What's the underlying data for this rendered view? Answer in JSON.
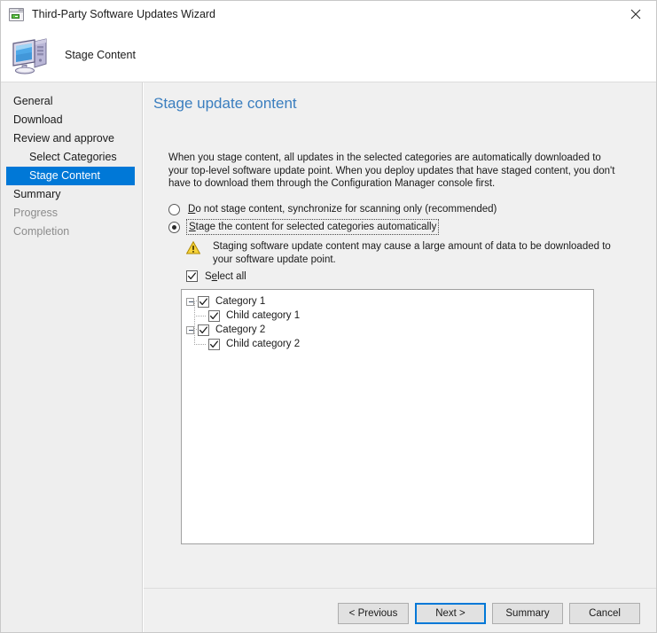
{
  "window": {
    "title": "Third-Party Software Updates Wizard",
    "title_icon": "wizard-window-icon",
    "close_icon": "close-icon"
  },
  "header": {
    "icon": "computer-icon",
    "title": "Stage Content"
  },
  "sidebar": {
    "items": [
      {
        "label": "General",
        "state": "normal",
        "indent": 0
      },
      {
        "label": "Download",
        "state": "normal",
        "indent": 0
      },
      {
        "label": "Review and approve",
        "state": "normal",
        "indent": 0
      },
      {
        "label": "Select Categories",
        "state": "normal",
        "indent": 1
      },
      {
        "label": "Stage Content",
        "state": "active",
        "indent": 1
      },
      {
        "label": "Summary",
        "state": "normal",
        "indent": 0
      },
      {
        "label": "Progress",
        "state": "disabled",
        "indent": 0
      },
      {
        "label": "Completion",
        "state": "disabled",
        "indent": 0
      }
    ]
  },
  "main": {
    "heading": "Stage update content",
    "intro": "When you stage content, all updates in the selected categories are automatically downloaded to your top-level software update point. When you deploy updates that have staged content, you don't have to download them through the Configuration Manager console first.",
    "options": [
      {
        "id": "do-not-stage",
        "label_prefix": "D",
        "label_rest": "o not stage content, synchronize for scanning only (recommended)",
        "checked": false,
        "focused": false
      },
      {
        "id": "stage-automatically",
        "label_prefix": "S",
        "label_rest": "tage the content for selected categories automatically",
        "checked": true,
        "focused": true
      }
    ],
    "warning": {
      "icon": "warning-triangle-icon",
      "text": "Staging software update content may cause a large amount of data to be downloaded to your software update point."
    },
    "select_all": {
      "label_prefix": "S",
      "label_mid": "e",
      "label_rest": "lect all",
      "checked": true
    },
    "tree": {
      "nodes": [
        {
          "label": "Category 1",
          "checked": true,
          "expanded": true,
          "children": [
            {
              "label": "Child category 1",
              "checked": true
            }
          ]
        },
        {
          "label": "Category 2",
          "checked": true,
          "expanded": true,
          "children": [
            {
              "label": "Child category 2",
              "checked": true
            }
          ]
        }
      ]
    }
  },
  "footer": {
    "previous": {
      "label": "< Previous",
      "accel": "P",
      "default": false
    },
    "next": {
      "label": "Next >",
      "accel": "N",
      "default": true
    },
    "summary": {
      "label": "Summary",
      "accel": "S",
      "default": false
    },
    "cancel": {
      "label": "Cancel",
      "accel": "",
      "default": false
    }
  },
  "colors": {
    "accent": "#0078d7",
    "heading": "#3a7ebf",
    "content_bg": "#f0f0f0",
    "sidebar_bg": "#eeeeee",
    "warning": "#f5c518"
  }
}
